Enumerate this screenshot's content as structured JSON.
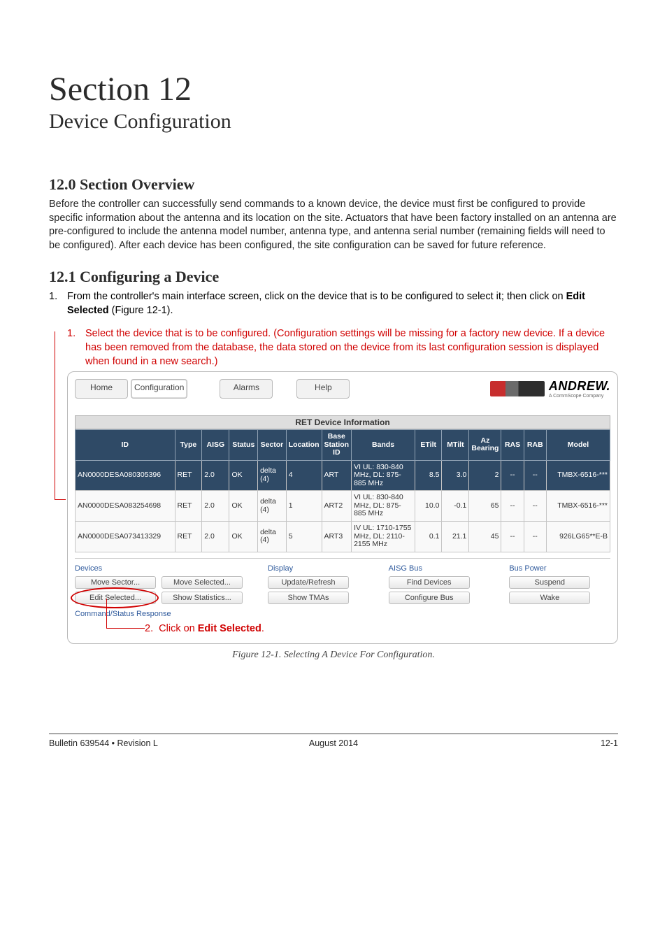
{
  "heading": {
    "section_number": "Section 12",
    "section_title": "Device Configuration"
  },
  "s12_0": {
    "title": "12.0 Section Overview",
    "text": "Before the controller can successfully send commands to a known device, the device must first be configured to provide specific information about the antenna and its location on the site. Actuators that have been factory installed on an antenna are pre-configured to include the antenna model number, antenna type, and antenna serial number (remaining fields will need to be configured). After each device has been configured, the site configuration can be saved for future reference."
  },
  "s12_1": {
    "title": "12.1 Configuring a Device",
    "step1_num": "1.",
    "step1_text_a": "From the controller's main interface screen, click on the device that is to be configured to select it; then click on ",
    "step1_text_bold": "Edit Selected",
    "step1_text_b": " (Figure 12-1)."
  },
  "annotation1": {
    "num": "1.",
    "text": "Select the device that is to be configured. (Configuration settings will be missing for a factory new device. If a device has been removed from the database, the data stored on the device from its last configuration session is displayed when found in a new search.)"
  },
  "annotation2": {
    "num": "2.",
    "text_a": "Click on ",
    "text_bold": "Edit Selected",
    "text_b": "."
  },
  "app": {
    "tabs": {
      "home": "Home",
      "configuration": "Configuration",
      "alarms": "Alarms",
      "help": "Help"
    },
    "brand": "ANDREW.",
    "brand_sub": "A CommScope Company",
    "panel_title": "RET Device Information",
    "columns": {
      "id": "ID",
      "type": "Type",
      "aisg": "AISG",
      "status": "Status",
      "sector": "Sector",
      "location": "Location",
      "base": "Base Station ID",
      "bands": "Bands",
      "etilt": "ETilt",
      "mtilt": "MTilt",
      "bearing": "Az Bearing",
      "ras": "RAS",
      "rab": "RAB",
      "model": "Model"
    },
    "rows": [
      {
        "id": "AN0000DESA080305396",
        "type": "RET",
        "aisg": "2.0",
        "status": "OK",
        "sector": "delta (4)",
        "location": "4",
        "base": "ART",
        "bands": "VI UL: 830-840 MHz, DL: 875-885 MHz",
        "etilt": "8.5",
        "mtilt": "3.0",
        "bearing": "2",
        "ras": "--",
        "rab": "--",
        "model": "TMBX-6516-***",
        "selected": true
      },
      {
        "id": "AN0000DESA083254698",
        "type": "RET",
        "aisg": "2.0",
        "status": "OK",
        "sector": "delta (4)",
        "location": "1",
        "base": "ART2",
        "bands": "VI UL: 830-840 MHz, DL: 875-885 MHz",
        "etilt": "10.0",
        "mtilt": "-0.1",
        "bearing": "65",
        "ras": "--",
        "rab": "--",
        "model": "TMBX-6516-***",
        "selected": false
      },
      {
        "id": "AN0000DESA073413329",
        "type": "RET",
        "aisg": "2.0",
        "status": "OK",
        "sector": "delta (4)",
        "location": "5",
        "base": "ART3",
        "bands": "IV UL: 1710-1755 MHz, DL: 2110-2155 MHz",
        "etilt": "0.1",
        "mtilt": "21.1",
        "bearing": "45",
        "ras": "--",
        "rab": "--",
        "model": "926LG65**E-B",
        "selected": false
      }
    ],
    "panels": {
      "devices": "Devices",
      "move_sector": "Move Sector...",
      "move_selected": "Move Selected...",
      "edit_selected": "Edit Selected...",
      "show_statistics": "Show Statistics...",
      "display": "Display",
      "update_refresh": "Update/Refresh",
      "show_tma": "Show TMAs",
      "aisg_bus": "AISG Bus",
      "find_devices": "Find Devices",
      "configure_bus": "Configure Bus",
      "bus_power": "Bus Power",
      "suspend": "Suspend",
      "wake": "Wake",
      "cmd_status": "Command/Status Response"
    }
  },
  "figure_caption": "Figure 12-1.  Selecting A Device For Configuration.",
  "footer": {
    "left": "Bulletin 639544  •  Revision L",
    "center": "August 2014",
    "right": "12-1"
  }
}
